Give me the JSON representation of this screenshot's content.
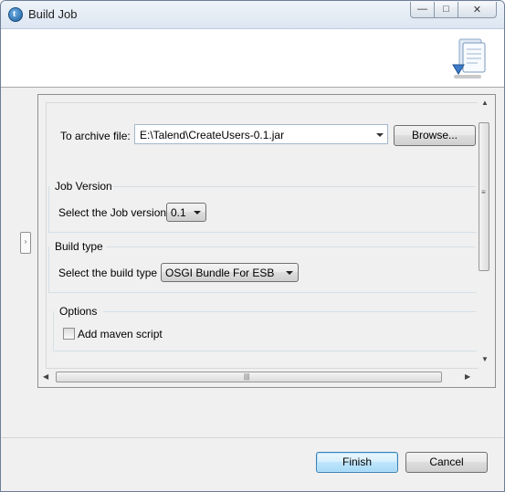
{
  "window": {
    "title": "Build Job",
    "app_icon": "talend-icon",
    "controls": [
      "minimize-icon",
      "maximize-icon",
      "close-icon"
    ]
  },
  "banner": {
    "icon": "build-job-wizard-icon"
  },
  "archive": {
    "label": "To archive file:",
    "value": "E:\\Talend\\CreateUsers-0.1.jar",
    "browse_label": "Browse..."
  },
  "job_version": {
    "group_title": "Job Version",
    "label": "Select the Job version",
    "selected": "0.1"
  },
  "build_type": {
    "group_title": "Build type",
    "label": "Select the build type",
    "selected": "OSGI Bundle For ESB"
  },
  "options": {
    "group_title": "Options",
    "add_maven_label": "Add maven script",
    "add_maven_checked": false
  },
  "footer": {
    "finish_label": "Finish",
    "cancel_label": "Cancel"
  }
}
